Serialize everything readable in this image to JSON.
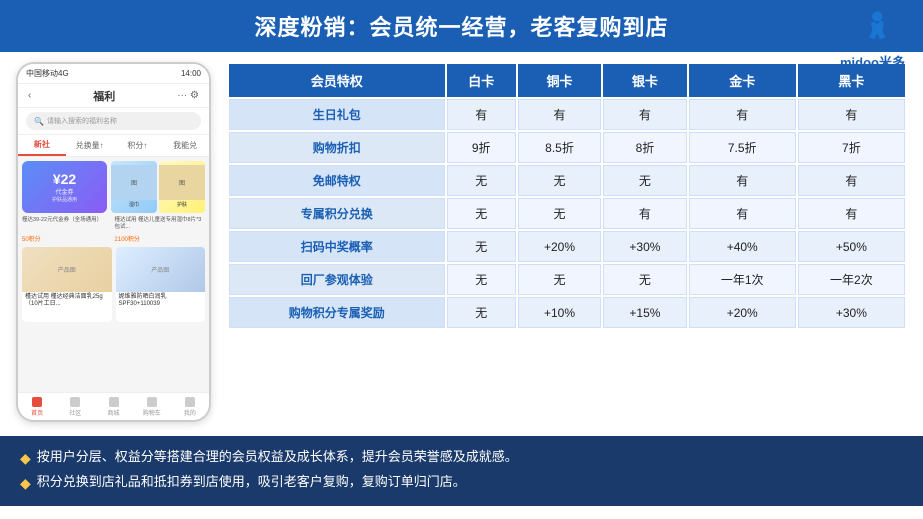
{
  "title": "深度粉销：会员统一经营，老客复购到店",
  "logo": {
    "text": "midoo米多",
    "alt": "midoo logo"
  },
  "phone": {
    "status_bar": "中国移动4G",
    "time": "14:00",
    "nav_title": "福利",
    "search_placeholder": "请输入搜索的福利名称",
    "tabs": [
      "新社",
      "兑换量↑",
      "积分↑",
      "我能兑"
    ],
    "active_tab": 0,
    "voucher_amount": "¥22",
    "voucher_desc": "代金券",
    "product1_title": "槿达39-22元代金券（全场通用）",
    "product1_points": "50积分",
    "product2_title": "槿达试用 槿达儿童送专用湿巾8片*3包试...",
    "product2_points": "2100积分",
    "product3_title": "槿达试用 槿达经典洁面乳25g（10片工日...",
    "product4_title": "妮维雅防晒白润乳SPF30+110039",
    "bottom_tabs": [
      "首页",
      "社区",
      "商城",
      "购物车",
      "我的"
    ],
    "active_bottom": 0
  },
  "table": {
    "headers": [
      "会员特权",
      "白卡",
      "铜卡",
      "银卡",
      "金卡",
      "黑卡"
    ],
    "rows": [
      [
        "生日礼包",
        "有",
        "有",
        "有",
        "有",
        "有"
      ],
      [
        "购物折扣",
        "9折",
        "8.5折",
        "8折",
        "7.5折",
        "7折"
      ],
      [
        "免邮特权",
        "无",
        "无",
        "无",
        "有",
        "有"
      ],
      [
        "专属积分兑换",
        "无",
        "无",
        "有",
        "有",
        "有"
      ],
      [
        "扫码中奖概率",
        "无",
        "+20%",
        "+30%",
        "+40%",
        "+50%"
      ],
      [
        "回厂参观体验",
        "无",
        "无",
        "无",
        "一年1次",
        "一年2次"
      ],
      [
        "购物积分专属奖励",
        "无",
        "+10%",
        "+15%",
        "+20%",
        "+30%"
      ]
    ]
  },
  "notes": [
    "按用户分层、权益分等搭建合理的会员权益及成长体系，提升会员荣誉感及成就感。",
    "积分兑换到店礼品和抵扣券到店使用，吸引老客户复购，复购订单归门店。"
  ]
}
